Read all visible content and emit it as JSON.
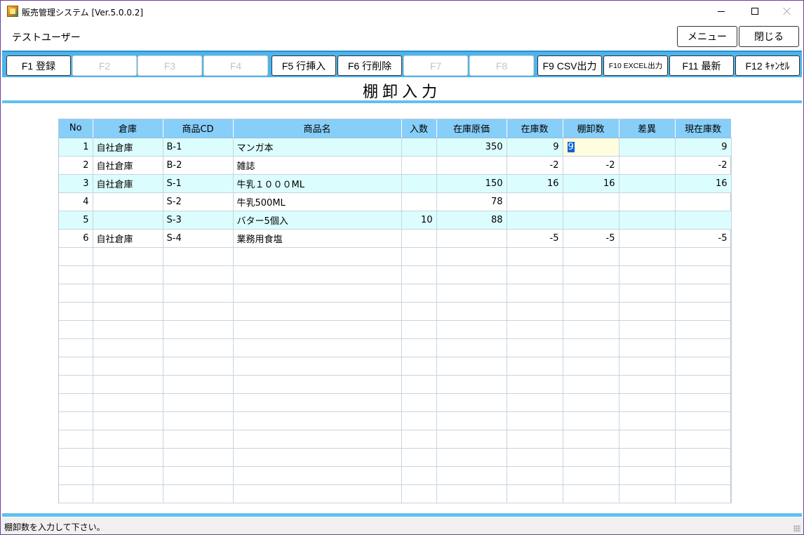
{
  "window": {
    "title": "販売管理システム [Ver.5.0.0.2]"
  },
  "header": {
    "user": "テストユーザー",
    "menu_label": "メニュー",
    "close_label": "閉じる"
  },
  "fkeys": [
    {
      "label": "F1 登録",
      "enabled": true
    },
    {
      "label": "F2",
      "enabled": false
    },
    {
      "label": "F3",
      "enabled": false
    },
    {
      "label": "F4",
      "enabled": false
    },
    {
      "label": "F5 行挿入",
      "enabled": true
    },
    {
      "label": "F6 行削除",
      "enabled": true
    },
    {
      "label": "F7",
      "enabled": false
    },
    {
      "label": "F8",
      "enabled": false
    },
    {
      "label": "F9 CSV出力",
      "enabled": true
    },
    {
      "label": "F10 EXCEL出力",
      "enabled": true
    },
    {
      "label": "F11 最新",
      "enabled": true
    },
    {
      "label": "F12 ｷｬﾝｾﾙ",
      "enabled": true
    }
  ],
  "page_title": "棚卸入力",
  "grid": {
    "columns": [
      "No",
      "倉庫",
      "商品CD",
      "商品名",
      "入数",
      "在庫原価",
      "在庫数",
      "棚卸数",
      "差異",
      "現在庫数"
    ],
    "rows": [
      {
        "no": "1",
        "warehouse": "自社倉庫",
        "code": "B-1",
        "name": "マンガ本",
        "qty_per": "",
        "cost": "350",
        "stock": "9",
        "count": "9",
        "diff": "",
        "current": "9"
      },
      {
        "no": "2",
        "warehouse": "自社倉庫",
        "code": "B-2",
        "name": "雑誌",
        "qty_per": "",
        "cost": "",
        "stock": "-2",
        "count": "-2",
        "diff": "",
        "current": "-2"
      },
      {
        "no": "3",
        "warehouse": "自社倉庫",
        "code": "S-1",
        "name": "牛乳１０００ML",
        "qty_per": "",
        "cost": "150",
        "stock": "16",
        "count": "16",
        "diff": "",
        "current": "16"
      },
      {
        "no": "4",
        "warehouse": "",
        "code": "S-2",
        "name": "牛乳500ML",
        "qty_per": "",
        "cost": "78",
        "stock": "",
        "count": "",
        "diff": "",
        "current": ""
      },
      {
        "no": "5",
        "warehouse": "",
        "code": "S-3",
        "name": "バター5個入",
        "qty_per": "10",
        "cost": "88",
        "stock": "",
        "count": "",
        "diff": "",
        "current": ""
      },
      {
        "no": "6",
        "warehouse": "自社倉庫",
        "code": "S-4",
        "name": "業務用食塩",
        "qty_per": "",
        "cost": "",
        "stock": "-5",
        "count": "-5",
        "diff": "",
        "current": "-5"
      }
    ],
    "empty_rows": 14
  },
  "status": {
    "message": "棚卸数を入力して下さい。"
  },
  "colors": {
    "fkey_bar": "#4fb4ea",
    "header_bg": "#87cef9",
    "alt_row": "#dcfdfd",
    "edit_cell": "#fffde0",
    "selection": "#0a64d8"
  }
}
